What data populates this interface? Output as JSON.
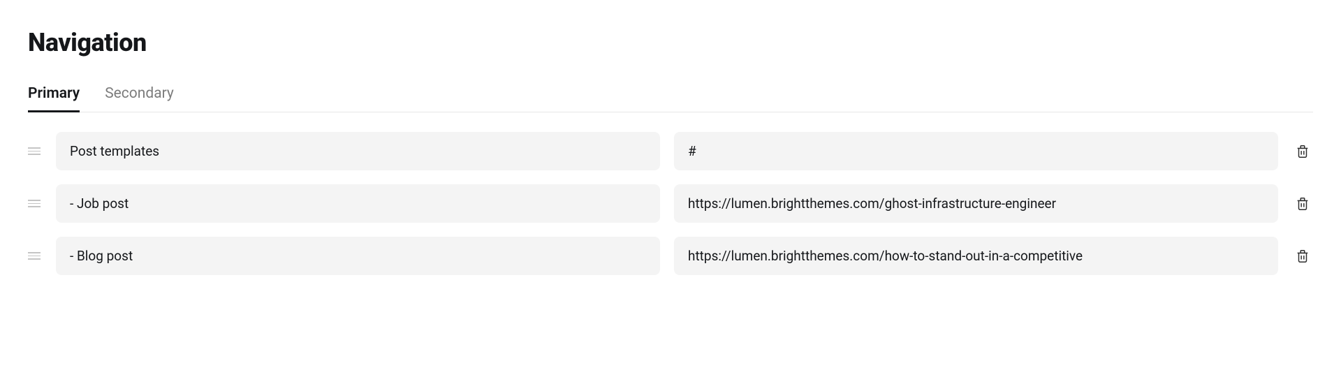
{
  "page": {
    "title": "Navigation"
  },
  "tabs": {
    "primary": "Primary",
    "secondary": "Secondary"
  },
  "rows": [
    {
      "label": "Post templates",
      "url": "#"
    },
    {
      "label": "- Job post",
      "url": "https://lumen.brightthemes.com/ghost-infrastructure-engineer"
    },
    {
      "label": "- Blog post",
      "url": "https://lumen.brightthemes.com/how-to-stand-out-in-a-competitive"
    }
  ]
}
